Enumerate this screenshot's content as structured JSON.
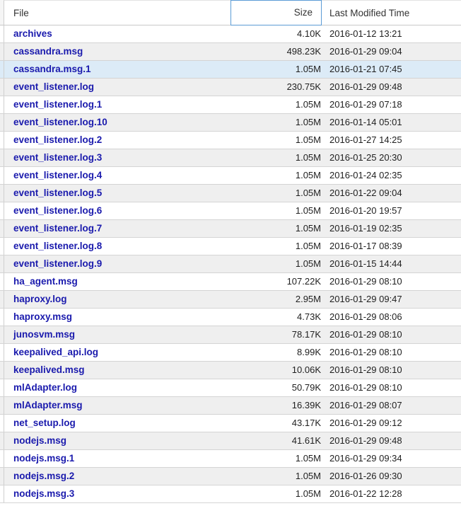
{
  "table": {
    "columns": [
      {
        "key": "file",
        "label": "File",
        "align": "left"
      },
      {
        "key": "size",
        "label": "Size",
        "align": "right",
        "focused": true
      },
      {
        "key": "date",
        "label": "Last Modified Time",
        "align": "left"
      }
    ],
    "header": {
      "file_label": "File",
      "size_label": "Size",
      "date_label": "Last Modified Time"
    },
    "colors": {
      "link_text": "#1a1aad",
      "row_alt_background": "#efefef",
      "row_selected_background": "#dcebf7",
      "header_focus_border": "#5b9bd5",
      "row_divider": "#d4d4d4"
    },
    "rows": [
      {
        "file": "archives",
        "size": "4.10K",
        "date": "2016-01-12 13:21",
        "style": "plain"
      },
      {
        "file": "cassandra.msg",
        "size": "498.23K",
        "date": "2016-01-29 09:04",
        "style": "alt"
      },
      {
        "file": "cassandra.msg.1",
        "size": "1.05M",
        "date": "2016-01-21 07:45",
        "style": "sel"
      },
      {
        "file": "event_listener.log",
        "size": "230.75K",
        "date": "2016-01-29 09:48",
        "style": "alt"
      },
      {
        "file": "event_listener.log.1",
        "size": "1.05M",
        "date": "2016-01-29 07:18",
        "style": "plain"
      },
      {
        "file": "event_listener.log.10",
        "size": "1.05M",
        "date": "2016-01-14 05:01",
        "style": "alt"
      },
      {
        "file": "event_listener.log.2",
        "size": "1.05M",
        "date": "2016-01-27 14:25",
        "style": "plain"
      },
      {
        "file": "event_listener.log.3",
        "size": "1.05M",
        "date": "2016-01-25 20:30",
        "style": "alt"
      },
      {
        "file": "event_listener.log.4",
        "size": "1.05M",
        "date": "2016-01-24 02:35",
        "style": "plain"
      },
      {
        "file": "event_listener.log.5",
        "size": "1.05M",
        "date": "2016-01-22 09:04",
        "style": "alt"
      },
      {
        "file": "event_listener.log.6",
        "size": "1.05M",
        "date": "2016-01-20 19:57",
        "style": "plain"
      },
      {
        "file": "event_listener.log.7",
        "size": "1.05M",
        "date": "2016-01-19 02:35",
        "style": "alt"
      },
      {
        "file": "event_listener.log.8",
        "size": "1.05M",
        "date": "2016-01-17 08:39",
        "style": "plain"
      },
      {
        "file": "event_listener.log.9",
        "size": "1.05M",
        "date": "2016-01-15 14:44",
        "style": "alt"
      },
      {
        "file": "ha_agent.msg",
        "size": "107.22K",
        "date": "2016-01-29 08:10",
        "style": "plain"
      },
      {
        "file": "haproxy.log",
        "size": "2.95M",
        "date": "2016-01-29 09:47",
        "style": "alt"
      },
      {
        "file": "haproxy.msg",
        "size": "4.73K",
        "date": "2016-01-29 08:06",
        "style": "plain"
      },
      {
        "file": "junosvm.msg",
        "size": "78.17K",
        "date": "2016-01-29 08:10",
        "style": "alt"
      },
      {
        "file": "keepalived_api.log",
        "size": "8.99K",
        "date": "2016-01-29 08:10",
        "style": "plain"
      },
      {
        "file": "keepalived.msg",
        "size": "10.06K",
        "date": "2016-01-29 08:10",
        "style": "alt"
      },
      {
        "file": "mlAdapter.log",
        "size": "50.79K",
        "date": "2016-01-29 08:10",
        "style": "plain"
      },
      {
        "file": "mlAdapter.msg",
        "size": "16.39K",
        "date": "2016-01-29 08:07",
        "style": "alt"
      },
      {
        "file": "net_setup.log",
        "size": "43.17K",
        "date": "2016-01-29 09:12",
        "style": "plain"
      },
      {
        "file": "nodejs.msg",
        "size": "41.61K",
        "date": "2016-01-29 09:48",
        "style": "alt"
      },
      {
        "file": "nodejs.msg.1",
        "size": "1.05M",
        "date": "2016-01-29 09:34",
        "style": "plain"
      },
      {
        "file": "nodejs.msg.2",
        "size": "1.05M",
        "date": "2016-01-26 09:30",
        "style": "alt"
      },
      {
        "file": "nodejs.msg.3",
        "size": "1.05M",
        "date": "2016-01-22 12:28",
        "style": "plain"
      }
    ]
  }
}
